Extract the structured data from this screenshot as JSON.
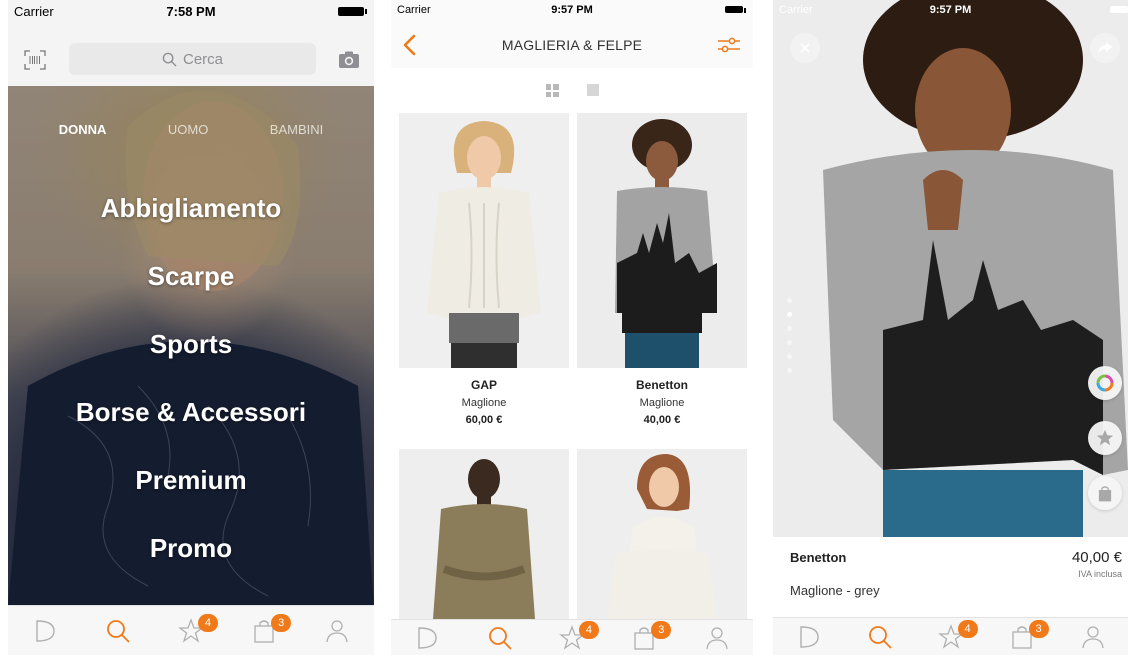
{
  "colors": {
    "accent": "#f07a1a",
    "tab_inactive": "#b0b0b0",
    "badge": "#f07a1a"
  },
  "screen1": {
    "status": {
      "carrier": "Carrier",
      "time": "7:58 PM"
    },
    "search": {
      "placeholder": "Cerca"
    },
    "gender_tabs": [
      "DONNA",
      "UOMO",
      "BAMBINI"
    ],
    "categories": [
      "Abbigliamento",
      "Scarpe",
      "Sports",
      "Borse & Accessori",
      "Premium",
      "Promo"
    ]
  },
  "screen2": {
    "status": {
      "carrier": "Carrier",
      "time": "9:57 PM"
    },
    "title": "MAGLIERIA & FELPE",
    "products": [
      {
        "brand": "GAP",
        "name": "Maglione",
        "price": "60,00 €"
      },
      {
        "brand": "Benetton",
        "name": "Maglione",
        "price": "40,00 €"
      }
    ]
  },
  "screen3": {
    "status": {
      "carrier": "Carrier",
      "time": "9:57 PM"
    },
    "brand": "Benetton",
    "price": "40,00 €",
    "vat": "IVA inclusa",
    "name": "Maglione - grey"
  },
  "tabbar": {
    "wishlist_count": "4",
    "cart_count": "3"
  }
}
